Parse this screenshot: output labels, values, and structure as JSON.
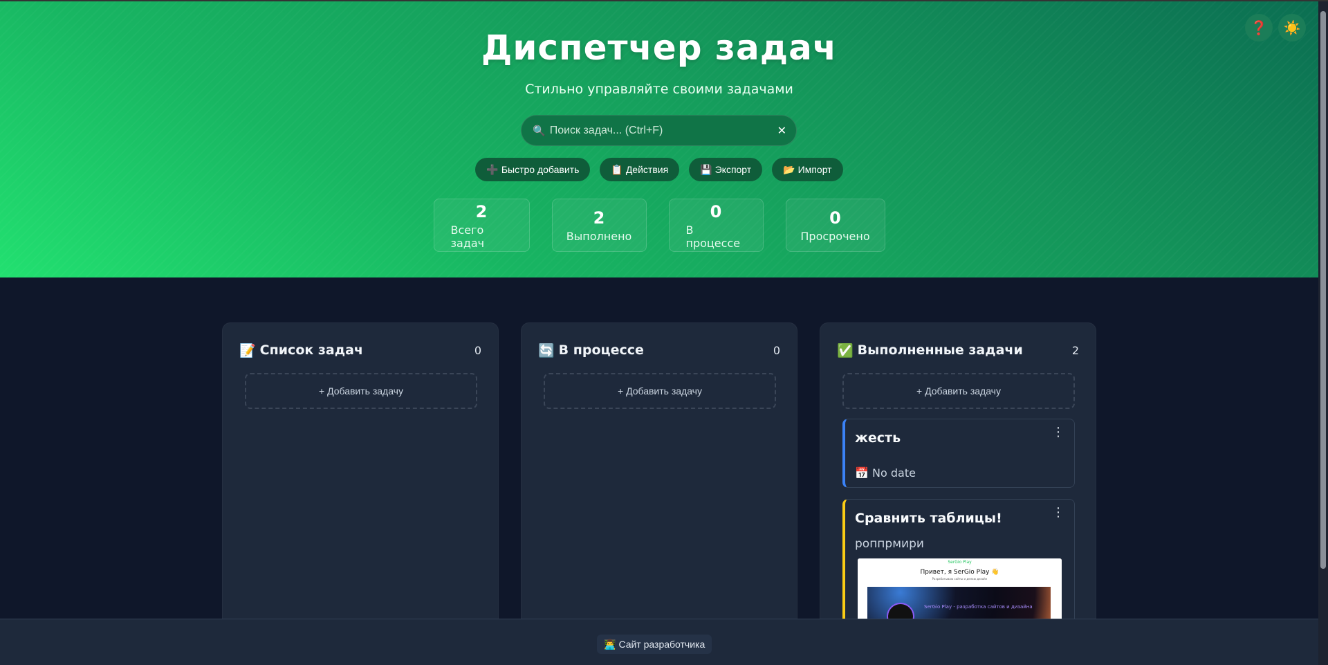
{
  "header": {
    "title": "Диспетчер задач",
    "subtitle": "Стильно управляйте своими задачами",
    "search": {
      "placeholder": "Поиск задач... (Ctrl+F)",
      "value": "",
      "clear_icon": "✕",
      "search_icon": "🔍"
    },
    "actions": [
      {
        "icon": "➕",
        "label": "Быстро добавить"
      },
      {
        "icon": "📋",
        "label": "Действия"
      },
      {
        "icon": "💾",
        "label": "Экспорт"
      },
      {
        "icon": "📂",
        "label": "Импорт"
      }
    ],
    "stats": [
      {
        "value": "2",
        "label": "Всего задач"
      },
      {
        "value": "2",
        "label": "Выполнено"
      },
      {
        "value": "0",
        "label": "В процессе"
      },
      {
        "value": "0",
        "label": "Просрочено"
      }
    ],
    "help_icon": "❓",
    "theme_icon": "☀️"
  },
  "columns": [
    {
      "icon": "📝",
      "title": "Список задач",
      "count": "0",
      "add_label": "+ Добавить задачу"
    },
    {
      "icon": "🔄",
      "title": "В процессе",
      "count": "0",
      "add_label": "+ Добавить задачу"
    },
    {
      "icon": "✅",
      "title": "Выполненные задачи",
      "count": "2",
      "add_label": "+ Добавить задачу"
    }
  ],
  "done_tasks": [
    {
      "title": "жесть",
      "date_icon": "📅",
      "date": "No date",
      "menu_icon": "⋮",
      "accent": "#3b82f6"
    },
    {
      "title": "Сравнить таблицы!",
      "description": "роппрмири",
      "menu_icon": "⋮",
      "accent": "#facc15"
    }
  ],
  "thumbnail": {
    "brand": "SerGio Play",
    "heading": "Привет, я SerGio Play 👋",
    "subheading": "Разрабатываю сайты и делаю дизайн",
    "banner_text": "SerGio Play - разработка сайтов и дизайна"
  },
  "footer": {
    "icon": "👨‍💻",
    "link_label": "Сайт разработчика"
  },
  "colors": {
    "hero_start": "#22e070",
    "hero_end": "#0b6e52",
    "background": "#0f172a",
    "column": "#1e293b"
  }
}
